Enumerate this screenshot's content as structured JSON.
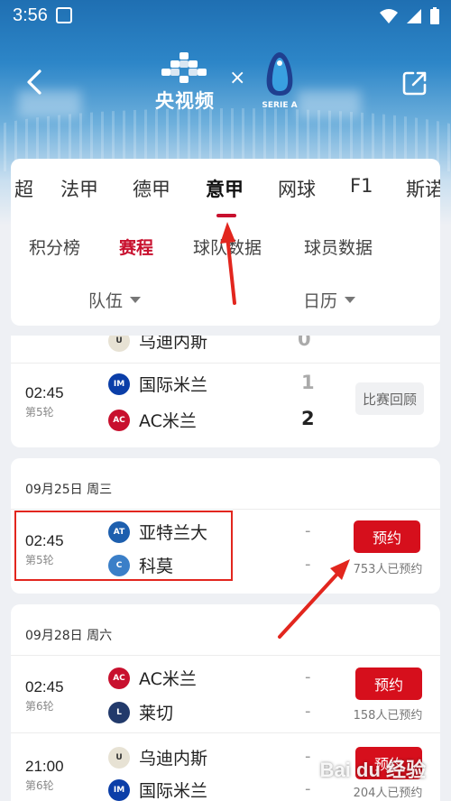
{
  "status_bar": {
    "time": "3:56"
  },
  "header": {
    "brand": "央视频",
    "times": "×",
    "serie_text": "SERIE A"
  },
  "league_tabs": [
    "超",
    "法甲",
    "德甲",
    "意甲",
    "网球",
    "F1",
    "斯诺"
  ],
  "sub_tabs": [
    "积分榜",
    "赛程",
    "球队数据",
    "球员数据"
  ],
  "filters": {
    "team": "队伍",
    "calendar": "日历"
  },
  "matches_top": {
    "partial_team": "乌迪内斯",
    "partial_score": "0",
    "time": "02:45",
    "round": "第5轮",
    "home": "国际米兰",
    "away": "AC米兰",
    "home_score": "1",
    "away_score": "2",
    "action": "比赛回顾"
  },
  "day_sep25": {
    "date": "09月25日 周三",
    "time": "02:45",
    "round": "第5轮",
    "home": "亚特兰大",
    "away": "科莫",
    "home_score": "-",
    "away_score": "-",
    "action": "预约",
    "booked": "753人已预约"
  },
  "day_sep28": {
    "date": "09月28日 周六",
    "m1": {
      "time": "02:45",
      "round": "第6轮",
      "home": "AC米兰",
      "away": "莱切",
      "home_score": "-",
      "away_score": "-",
      "action": "预约",
      "booked": "158人已预约"
    },
    "m2": {
      "time": "21:00",
      "round": "第6轮",
      "home": "乌迪内斯",
      "away": "国际米兰",
      "home_score": "-",
      "away_score": "-",
      "action": "预约",
      "booked": "204人已预约"
    }
  },
  "watermark": "Bai du 经验",
  "colors": {
    "accent": "#c8102e",
    "button": "#d60f1c",
    "annotation": "#e2261e"
  }
}
